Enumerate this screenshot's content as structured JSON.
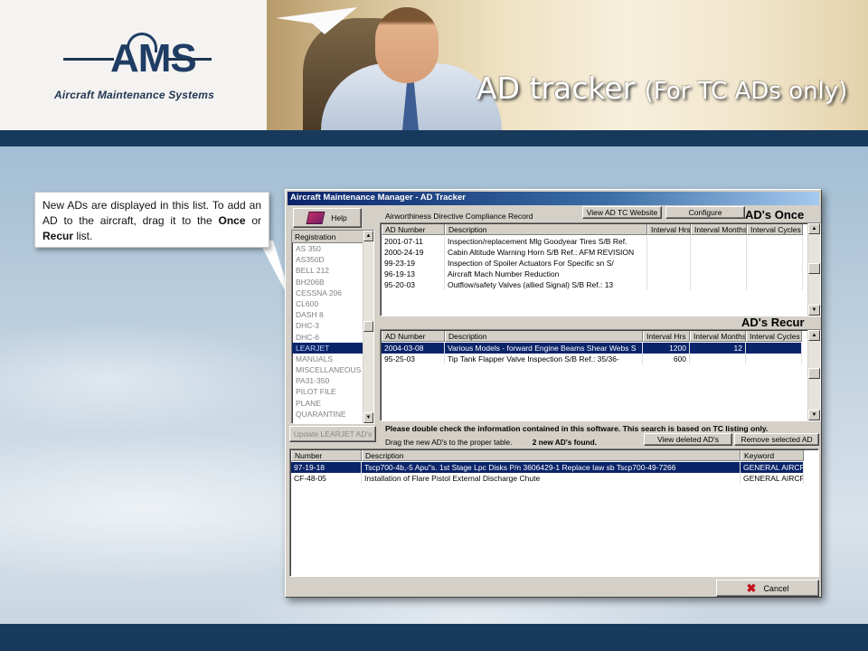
{
  "slide": {
    "logo_text": "AMS",
    "logo_subtitle": "Aircraft Maintenance Systems",
    "title_main": "AD tracker",
    "title_sub": "(For TC ADs only)",
    "callout": {
      "line_part1": "New ADs are displayed in this list. To add an AD to the aircraft, drag it to the ",
      "once_word": "Once",
      "or_word": " or ",
      "recur_word": "Recur",
      "line_end": " list."
    }
  },
  "window": {
    "title": "Aircraft Maintenance Manager - AD Tracker",
    "help_label": "Help",
    "compliance_label": "Airworthiness Directive Compliance Record",
    "view_website_label": "View AD TC Website",
    "configure_label": "Configure",
    "ads_once_label": "AD's Once",
    "ads_recur_label": "AD's Recur",
    "registration": {
      "header": "Registration",
      "items": [
        "AS 350",
        "AS350D",
        "BELL 212",
        "BH206B",
        "CESSNA 206",
        "CL600",
        "DASH 8",
        "DHC-3",
        "DHC-6",
        "LEARJET",
        "MANUALS",
        "MISCELLANEOUS",
        "PA31-350",
        "PILOT FILE",
        "PLANE",
        "QUARANTINE"
      ],
      "selected": "LEARJET"
    },
    "once_table": {
      "columns": [
        "AD Number",
        "Description",
        "Interval Hrs",
        "Interval Months",
        "Interval Cycles"
      ],
      "rows": [
        [
          "2001-07-11",
          "Inspection/replacement Mlg Goodyear Tires S/B Ref.",
          "",
          "",
          ""
        ],
        [
          "2000-24-19",
          "Cabin Altitude Warning Horn S/B Ref.: AFM REVISION",
          "",
          "",
          ""
        ],
        [
          "99-23-19",
          "Inspection of Spoiler Actuators For Specific sn S/",
          "",
          "",
          ""
        ],
        [
          "96-19-13",
          "Aircraft Mach Number Reduction",
          "",
          "",
          ""
        ],
        [
          "95-20-03",
          "Outflow/safety Valves (allied Signal) S/B Ref.: 13",
          "",
          "",
          ""
        ]
      ]
    },
    "recur_table": {
      "columns": [
        "AD Number",
        "Description",
        "Interval Hrs",
        "Interval Months",
        "Interval Cycles"
      ],
      "rows": [
        [
          "2004-03-08",
          "Various Models - forward Engine Beams Shear Webs S",
          "1200",
          "12",
          ""
        ],
        [
          "95-25-03",
          "Tip Tank Flapper Valve Inspection S/B Ref.: 35/36-",
          "600",
          "",
          ""
        ]
      ],
      "selected_row": 0
    },
    "update_button": "Update LEARJET AD's",
    "notice": "Please double check the information contained in this software. This search is based on TC listing only.",
    "drag_hint": "Drag the new AD's to the proper table.",
    "new_found": "2 new AD's found.",
    "view_deleted_label": "View deleted AD's",
    "remove_selected_label": "Remove selected AD",
    "new_table": {
      "columns": [
        "Number",
        "Description",
        "Keyword"
      ],
      "rows": [
        [
          "97-19-18",
          "Tscp700-4b,-5 Apu\"s. 1st Stage Lpc Disks P/n 3606429-1 Replace Iaw sb Tscp700-49-7266",
          "GENERAL AIRCR"
        ],
        [
          "CF-48-05",
          "Installation of Flare Pistol External Discharge Chute",
          "GENERAL AIRCR"
        ]
      ],
      "selected_row": 0
    },
    "cancel_label": "Cancel"
  }
}
